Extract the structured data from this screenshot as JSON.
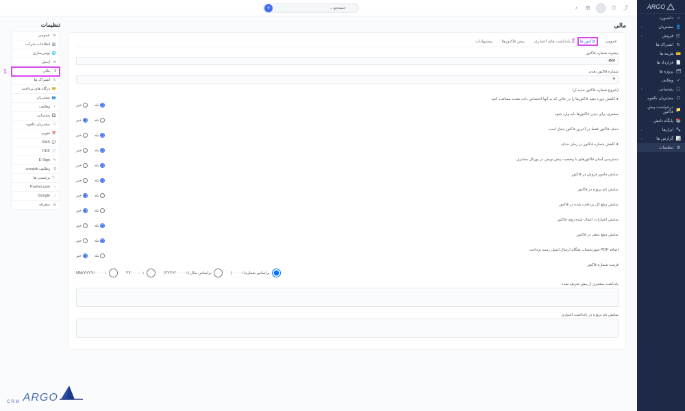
{
  "brand": {
    "name": "ARGO",
    "sub": "CRM"
  },
  "sidebar": {
    "logo": "ARGO",
    "items": [
      {
        "label": "داشبورد",
        "icon": "⌂"
      },
      {
        "label": "مشتریان",
        "icon": "👤",
        "chev": true
      },
      {
        "label": "فروش",
        "icon": "🛒",
        "chev": true
      },
      {
        "label": "اشتراک ها",
        "icon": "↻"
      },
      {
        "label": "هزینه ها",
        "icon": "💳"
      },
      {
        "label": "قرارداد ها",
        "icon": "📄"
      },
      {
        "label": "پروژه ها",
        "icon": "🗂"
      },
      {
        "label": "وظایف",
        "icon": "✓"
      },
      {
        "label": "پشتیبانی",
        "icon": "🎧",
        "chev": true
      },
      {
        "label": "مشتریان بالقوه",
        "icon": "☐"
      },
      {
        "label": "درخواست پیش فاکتور",
        "icon": "📁"
      },
      {
        "label": "پایگاه دانش",
        "icon": "📚"
      },
      {
        "label": "ابزارها",
        "icon": "🔧",
        "chev": true
      },
      {
        "label": "گزارش ها",
        "icon": "📊",
        "chev": true
      },
      {
        "label": "تنظیمات",
        "icon": "⚙",
        "active": true
      }
    ]
  },
  "topbar": {
    "search_placeholder": "جستجو..."
  },
  "settings": {
    "title": "تنظیمات",
    "items": [
      {
        "label": "عمومی",
        "icon": "⚙"
      },
      {
        "label": "اطلاعات شرکت",
        "icon": "🏢"
      },
      {
        "label": "بومی‌سازی",
        "icon": "🌐"
      },
      {
        "label": "ایمیل",
        "icon": "✉"
      },
      {
        "label": "مالی",
        "icon": "$",
        "highlighted": true,
        "num": "1"
      },
      {
        "label": "اشتراک ها",
        "icon": "↻"
      },
      {
        "label": "درگاه های پرداخت",
        "icon": "💳"
      },
      {
        "label": "مشتریان",
        "icon": "👥"
      },
      {
        "label": "وظایف",
        "icon": "✓"
      },
      {
        "label": "پشتیبانی",
        "icon": "🎧"
      },
      {
        "label": "مشتریان بالقوه",
        "icon": "☐"
      },
      {
        "label": "تقویم",
        "icon": "📅"
      },
      {
        "label": "SMS",
        "icon": "💬"
      },
      {
        "label": "PDF",
        "icon": "📄"
      },
      {
        "label": "E-Sign",
        "icon": "✎"
      },
      {
        "label": "وظایف cronjob",
        "icon": "⏱"
      },
      {
        "label": "برچسب ها",
        "icon": "🏷"
      },
      {
        "label": "Pusher.com",
        "icon": "○"
      },
      {
        "label": "Google",
        "icon": "○"
      },
      {
        "label": "متفرقه",
        "icon": "☰"
      }
    ]
  },
  "panel": {
    "title": "مالی",
    "tabs": [
      {
        "label": "عمومی"
      },
      {
        "label": "فاکتور ها",
        "highlighted": true,
        "num": "2",
        "active": true
      },
      {
        "label": "یادداشت های اعتباری"
      },
      {
        "label": "پیش فاکتورها"
      },
      {
        "label": "پیشنهادات"
      }
    ],
    "fields": {
      "prefix_label": "پیشوند شماره فاکتور",
      "prefix_value": "INV-",
      "next_num_label": "شماره فاکتور بعدی",
      "next_num_value": "۳",
      "next_num_hint": "(شروع شماره فاکتور جدید از)",
      "decrement_label": "● کاهش دوره دهید فاکتورها زا در حالی که به آنها اختصاص داده نشده مشاهده کنید",
      "require_login_label": "مشتری برای دیدن فاکتورها باید وارد شود",
      "delete_last_label": "حذف فاکتور فقط در آخرین فاکتور مجاز است",
      "decrement_on_delete_label": "● کاهش شماره فاکتور در زمان حذف",
      "show_draft_label": "دسترسی آسان فاکتورهای با وضعیت پیش نویس در پورتال مشتری",
      "show_agent_label": "نمایش مامور فروش در فاکتور",
      "show_project_label": "نمایش نام پروژه در فاکتور",
      "show_total_paid_label": "نمایش مبلغ کل پرداخت شده در فاکتور",
      "show_credits_label": "نمایش اعتبارات اعمال شده روی فاکتور",
      "show_balance_label": "نمایش مبلغ بدهی در فاکتور",
      "pdf_attach_label": "اضافه PDF صورتحساب هنگام ارسال ایمیل رسید پرداخت",
      "yes": "بله",
      "no": "خیر",
      "format_label": "فرمت شماره فاکتور",
      "format_options": [
        "براساس شماره(۰۰۰۰۰۱)",
        "براساس سال (YYYY/۰۰۰۰۰۱)",
        "۰۰۰۰۰۱-YY",
        "۰۰۰۰۰۱/MM/YYYY"
      ],
      "predefined_note_label": "یادداشت مشتری از پیش تعریف شده",
      "predefined_terms_label": "نمایش نام پروژه در یادداشت اعتباری"
    }
  }
}
